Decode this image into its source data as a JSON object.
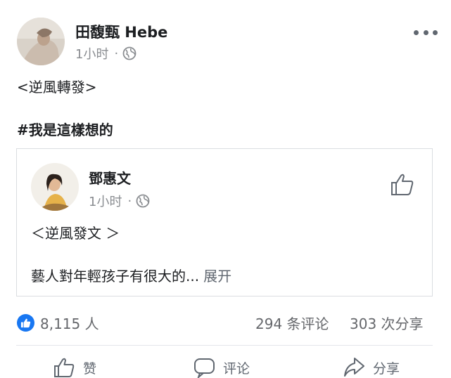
{
  "post": {
    "author": "田馥甄 Hebe",
    "time": "1小时",
    "dot": "·",
    "body_line1": "<逆風轉發>",
    "hashtag": "#我是這樣想的"
  },
  "shared": {
    "author": "鄧惠文",
    "time": "1小时",
    "dot": "·",
    "title": "＜逆風發文 ＞",
    "excerpt": "藝人對年輕孩子有很大的...",
    "expand_label": "展开"
  },
  "stats": {
    "reactions": "8,115 人",
    "comments": "294 条评论",
    "shares": "303 次分享"
  },
  "actions": {
    "like": "赞",
    "comment": "评论",
    "share": "分享"
  },
  "colors": {
    "accent": "#1877f2",
    "muted": "#8a8d91",
    "text": "#1c1e21"
  },
  "icons": {
    "globe": "globe-icon",
    "more": "more-icon",
    "like": "thumbs-up-icon",
    "comment": "comment-icon",
    "share": "share-icon"
  }
}
